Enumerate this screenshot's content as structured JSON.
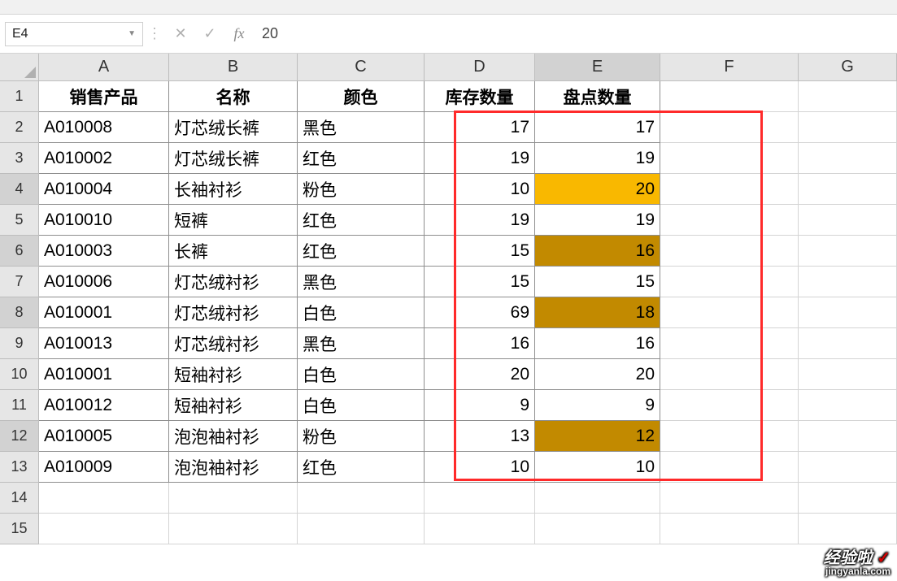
{
  "formula_bar": {
    "cell_ref": "E4",
    "value": "20"
  },
  "columns": [
    "A",
    "B",
    "C",
    "D",
    "E",
    "F",
    "G"
  ],
  "headers": {
    "A": "销售产品",
    "B": "名称",
    "C": "颜色",
    "D": "库存数量",
    "E": "盘点数量"
  },
  "rows": [
    {
      "n": "2",
      "A": "A010008",
      "B": "灯芯绒长裤",
      "C": "黑色",
      "D": "17",
      "E": "17",
      "hl": false
    },
    {
      "n": "3",
      "A": "A010002",
      "B": "灯芯绒长裤",
      "C": "红色",
      "D": "19",
      "E": "19",
      "hl": false
    },
    {
      "n": "4",
      "A": "A010004",
      "B": "长袖衬衫",
      "C": "粉色",
      "D": "10",
      "E": "20",
      "hl": true,
      "hlClass": "hlcell1"
    },
    {
      "n": "5",
      "A": "A010010",
      "B": "短裤",
      "C": "红色",
      "D": "19",
      "E": "19",
      "hl": false
    },
    {
      "n": "6",
      "A": "A010003",
      "B": "长裤",
      "C": "红色",
      "D": "15",
      "E": "16",
      "hl": true,
      "hlClass": "hlcell2"
    },
    {
      "n": "7",
      "A": "A010006",
      "B": "灯芯绒衬衫",
      "C": "黑色",
      "D": "15",
      "E": "15",
      "hl": false
    },
    {
      "n": "8",
      "A": "A010001",
      "B": "灯芯绒衬衫",
      "C": "白色",
      "D": "69",
      "E": "18",
      "hl": true,
      "hlClass": "hlcell2"
    },
    {
      "n": "9",
      "A": "A010013",
      "B": "灯芯绒衬衫",
      "C": "黑色",
      "D": "16",
      "E": "16",
      "hl": false
    },
    {
      "n": "10",
      "A": "A010001",
      "B": "短袖衬衫",
      "C": "白色",
      "D": "20",
      "E": "20",
      "hl": false
    },
    {
      "n": "11",
      "A": "A010012",
      "B": "短袖衬衫",
      "C": "白色",
      "D": "9",
      "E": "9",
      "hl": false
    },
    {
      "n": "12",
      "A": "A010005",
      "B": "泡泡袖衬衫",
      "C": "粉色",
      "D": "13",
      "E": "12",
      "hl": true,
      "hlClass": "hlcell2"
    },
    {
      "n": "13",
      "A": "A010009",
      "B": "泡泡袖衬衫",
      "C": "红色",
      "D": "10",
      "E": "10",
      "hl": false
    }
  ],
  "empty_rows": [
    "14",
    "15"
  ],
  "watermark": {
    "main": "经验啦",
    "check": "✓",
    "sub": "jingyanla.com"
  },
  "active_col": "E",
  "hl_row_heads": [
    "4",
    "6",
    "8",
    "12"
  ]
}
